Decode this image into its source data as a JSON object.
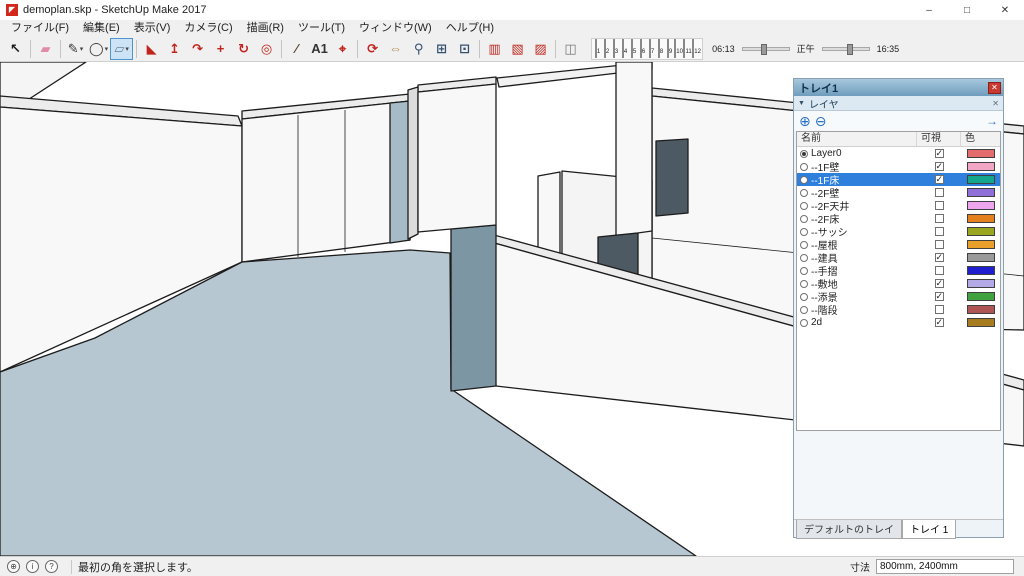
{
  "window": {
    "title": "demoplan.skp - SketchUp Make 2017",
    "icon_glyph": "◤",
    "minimize": "–",
    "restore": "□",
    "close": "✕"
  },
  "menubar": {
    "items": [
      "ファイル(F)",
      "編集(E)",
      "表示(V)",
      "カメラ(C)",
      "描画(R)",
      "ツール(T)",
      "ウィンドウ(W)",
      "ヘルプ(H)"
    ]
  },
  "toolbar": {
    "tools": [
      {
        "name": "select-tool",
        "icon": "select-icon",
        "glyph": "↖",
        "color": "#1a1a1a",
        "dropdown": false,
        "active": false,
        "sep": false
      },
      {
        "name": "eraser-tool",
        "icon": "eraser-icon",
        "glyph": "▰",
        "color": "#e08ca8",
        "dropdown": false,
        "active": false,
        "sep": true
      },
      {
        "name": "line-tool",
        "icon": "line-icon",
        "glyph": "✎",
        "color": "#333333",
        "dropdown": true,
        "active": false,
        "sep": true
      },
      {
        "name": "shapes-tool",
        "icon": "shapes-icon",
        "glyph": "◯",
        "color": "#333333",
        "dropdown": true,
        "active": false,
        "sep": false
      },
      {
        "name": "rectangle-tool",
        "icon": "rectangle-icon",
        "glyph": "▱",
        "color": "#6e8494",
        "dropdown": true,
        "active": true,
        "sep": false
      },
      {
        "name": "paint-bucket-tool",
        "icon": "paint-bucket-icon",
        "glyph": "◣",
        "color": "#c0241c",
        "dropdown": false,
        "active": false,
        "sep": true
      },
      {
        "name": "push-pull-tool",
        "icon": "push-pull-icon",
        "glyph": "↥",
        "color": "#c0241c",
        "dropdown": false,
        "active": false,
        "sep": false
      },
      {
        "name": "follow-me-tool",
        "icon": "follow-me-icon",
        "glyph": "↷",
        "color": "#c0241c",
        "dropdown": false,
        "active": false,
        "sep": false
      },
      {
        "name": "move-tool",
        "icon": "move-icon",
        "glyph": "+",
        "color": "#c0241c",
        "dropdown": false,
        "active": false,
        "sep": false
      },
      {
        "name": "rotate-tool",
        "icon": "rotate-icon",
        "glyph": "↻",
        "color": "#c0241c",
        "dropdown": false,
        "active": false,
        "sep": false
      },
      {
        "name": "offset-tool",
        "icon": "offset-icon",
        "glyph": "◎",
        "color": "#c0241c",
        "dropdown": false,
        "active": false,
        "sep": false
      },
      {
        "name": "tape-measure-tool",
        "icon": "tape-measure-icon",
        "glyph": "∕",
        "color": "#5a4632",
        "dropdown": false,
        "active": false,
        "sep": true
      },
      {
        "name": "text-tool",
        "icon": "text-icon",
        "glyph": "A1",
        "color": "#333333",
        "dropdown": false,
        "active": false,
        "sep": false
      },
      {
        "name": "axes-tool",
        "icon": "axes-icon",
        "glyph": "⌖",
        "color": "#c0241c",
        "dropdown": false,
        "active": false,
        "sep": false
      },
      {
        "name": "orbit-tool",
        "icon": "orbit-icon",
        "glyph": "⟳",
        "color": "#c0241c",
        "dropdown": false,
        "active": false,
        "sep": true
      },
      {
        "name": "pan-tool",
        "icon": "pan-icon",
        "glyph": "⇔",
        "color": "#b08950",
        "dropdown": false,
        "active": false,
        "sep": false
      },
      {
        "name": "zoom-tool",
        "icon": "zoom-icon",
        "glyph": "⚲",
        "color": "#33506e",
        "dropdown": false,
        "active": false,
        "sep": false
      },
      {
        "name": "zoom-window-tool",
        "icon": "zoom-window-icon",
        "glyph": "⊞",
        "color": "#33506e",
        "dropdown": false,
        "active": false,
        "sep": false
      },
      {
        "name": "zoom-extents-tool",
        "icon": "zoom-extents-icon",
        "glyph": "⊡",
        "color": "#33506e",
        "dropdown": false,
        "active": false,
        "sep": false
      },
      {
        "name": "section-plane-tool",
        "icon": "section-plane-icon",
        "glyph": "▥",
        "color": "#c0241c",
        "dropdown": false,
        "active": false,
        "sep": true
      },
      {
        "name": "section-fill-tool",
        "icon": "section-fill-icon",
        "glyph": "▧",
        "color": "#c0241c",
        "dropdown": false,
        "active": false,
        "sep": false
      },
      {
        "name": "section-display-tool",
        "icon": "section-display-icon",
        "glyph": "▨",
        "color": "#c0241c",
        "dropdown": false,
        "active": false,
        "sep": false
      },
      {
        "name": "shadows-toggle",
        "icon": "shadows-icon",
        "glyph": "◫",
        "color": "#777777",
        "dropdown": false,
        "active": false,
        "sep": true
      }
    ],
    "shadows": {
      "months": [
        {
          "n": "1",
          "color": "#3a5fc8"
        },
        {
          "n": "2",
          "color": "#3fa9dc"
        },
        {
          "n": "3",
          "color": "#3fc08f"
        },
        {
          "n": "4",
          "color": "#7cc83f"
        },
        {
          "n": "5",
          "color": "#d8dc3a"
        },
        {
          "n": "6",
          "color": "#f2cf35"
        },
        {
          "n": "7",
          "color": "#f2a435"
        },
        {
          "n": "8",
          "color": "#ef7a32"
        },
        {
          "n": "9",
          "color": "#e5522e"
        },
        {
          "n": "10",
          "color": "#c83a50"
        },
        {
          "n": "11",
          "color": "#8c46b4"
        },
        {
          "n": "12",
          "color": "#4a4fb4"
        }
      ],
      "time_start": "06:13",
      "noon": "正午",
      "time_end": "16:35"
    }
  },
  "viewport": {
    "floor_color": "#b7c7d1",
    "shadow_wall_color": "#7d96a4",
    "opening_color": "#4e5a63"
  },
  "tray": {
    "title": "トレイ1",
    "close_glyph": "✕",
    "section": {
      "collapse_glyph": "▼",
      "label": "レイヤ",
      "close_glyph": "✕"
    },
    "add_glyph": "⊕",
    "remove_glyph": "⊖",
    "detail_glyph": "→",
    "columns": {
      "name": "名前",
      "visible": "可視",
      "color": "色"
    },
    "layers": [
      {
        "name": "Layer0",
        "current": true,
        "visible": true,
        "color": "#e46c6c",
        "selected": false
      },
      {
        "name": "--1F壁",
        "current": false,
        "visible": true,
        "color": "#f2a6c5",
        "selected": false
      },
      {
        "name": "--1F床",
        "current": false,
        "visible": true,
        "color": "#13a68c",
        "selected": true
      },
      {
        "name": "--2F壁",
        "current": false,
        "visible": false,
        "color": "#8f6fd8",
        "selected": false
      },
      {
        "name": "--2F天井",
        "current": false,
        "visible": false,
        "color": "#eda6ed",
        "selected": false
      },
      {
        "name": "--2F床",
        "current": false,
        "visible": false,
        "color": "#e5801f",
        "selected": false
      },
      {
        "name": "--サッシ",
        "current": false,
        "visible": false,
        "color": "#9ba621",
        "selected": false
      },
      {
        "name": "--屋根",
        "current": false,
        "visible": false,
        "color": "#e9a02a",
        "selected": false
      },
      {
        "name": "--建具",
        "current": false,
        "visible": true,
        "color": "#9a9a9a",
        "selected": false
      },
      {
        "name": "--手摺",
        "current": false,
        "visible": false,
        "color": "#1f1fd0",
        "selected": false
      },
      {
        "name": "--敷地",
        "current": false,
        "visible": true,
        "color": "#b3a9e6",
        "selected": false
      },
      {
        "name": "--添景",
        "current": false,
        "visible": true,
        "color": "#3fa23f",
        "selected": false
      },
      {
        "name": "--階段",
        "current": false,
        "visible": false,
        "color": "#b05555",
        "selected": false
      },
      {
        "name": "2d",
        "current": false,
        "visible": true,
        "color": "#a67c1e",
        "selected": false
      }
    ],
    "tabs": [
      {
        "label": "デフォルトのトレイ",
        "active": false
      },
      {
        "label": "トレイ 1",
        "active": true
      }
    ]
  },
  "statusbar": {
    "icons": [
      {
        "name": "geolocation-icon",
        "glyph": "⊕"
      },
      {
        "name": "info-icon",
        "glyph": "i"
      },
      {
        "name": "help-icon",
        "glyph": "?"
      }
    ],
    "message": "最初の角を選択します。",
    "measure_label": "寸法",
    "measure_value": "800mm, 2400mm"
  }
}
